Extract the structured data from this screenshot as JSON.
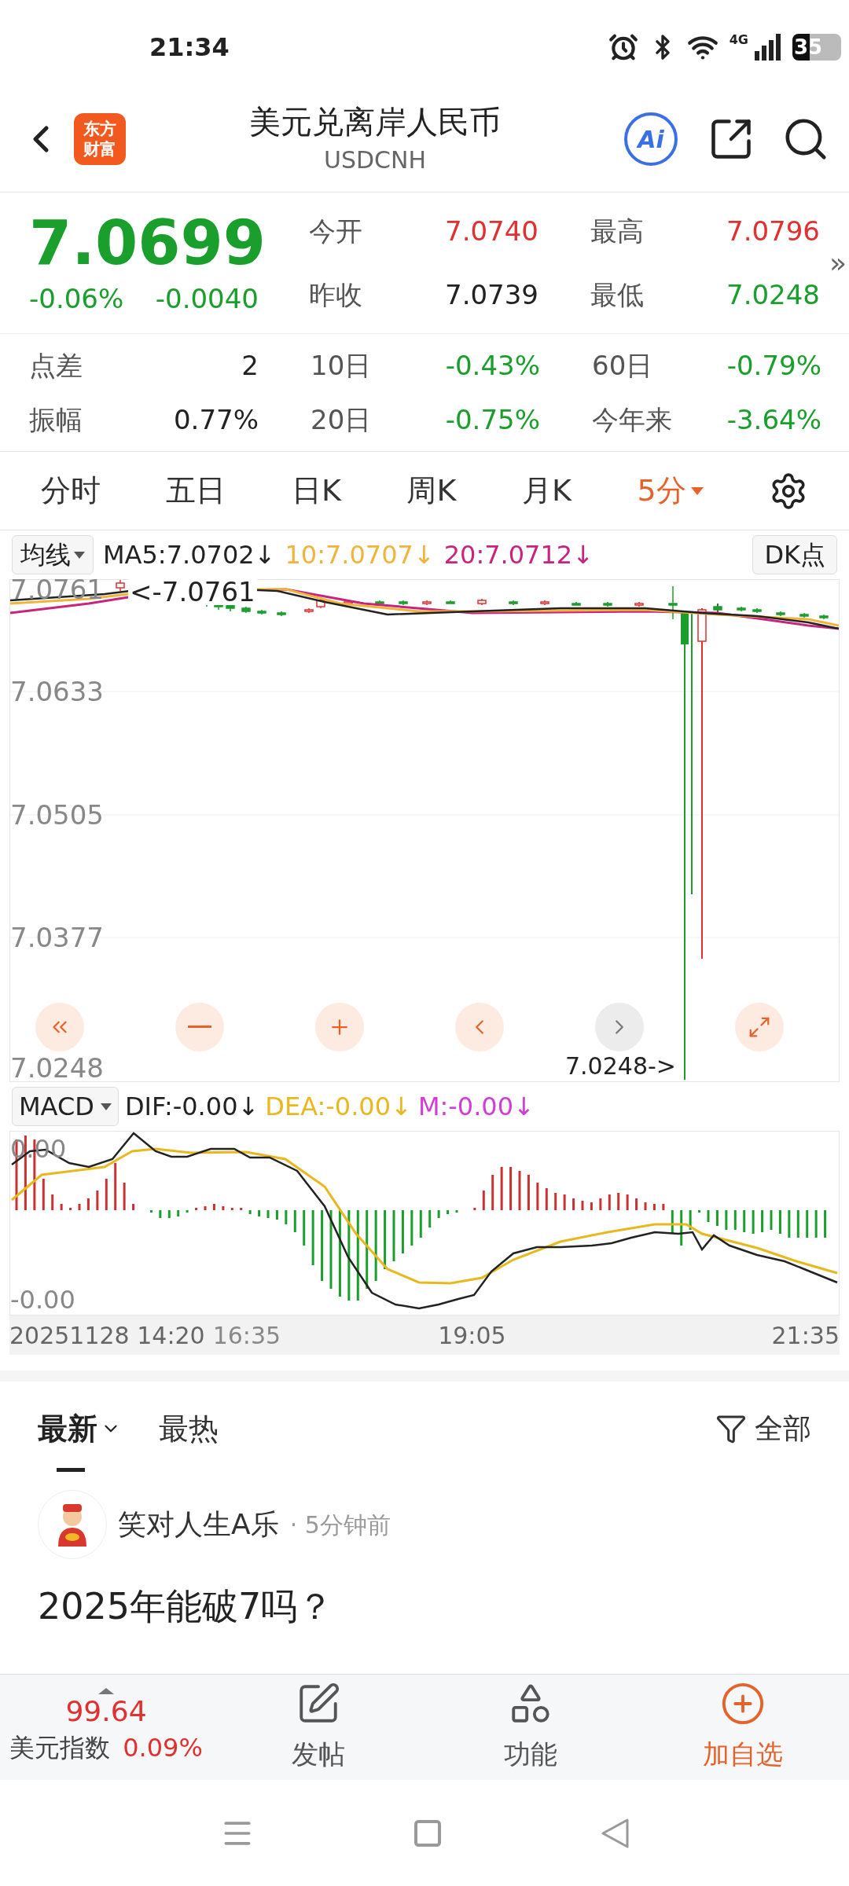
{
  "status_bar": {
    "time": "21:34",
    "network": "4G",
    "battery": "35"
  },
  "header": {
    "logo": [
      "东方",
      "财富"
    ],
    "title": "美元兑离岸人民币",
    "code": "USDCNH",
    "ai": "Ai"
  },
  "quote": {
    "price": "7.0699",
    "change_pct": "-0.06%",
    "change": "-0.0040",
    "color": "#1a9e2c",
    "stats": [
      {
        "label": "今开",
        "value": "7.0740",
        "color": "#e03030"
      },
      {
        "label": "最高",
        "value": "7.0796",
        "color": "#e03030"
      },
      {
        "label": "昨收",
        "value": "7.0739",
        "color": "#222222"
      },
      {
        "label": "最低",
        "value": "7.0248",
        "color": "#1a9e2c"
      }
    ],
    "more": "»"
  },
  "metrics": [
    {
      "label": "点差",
      "value": "2",
      "color": "#222222"
    },
    {
      "label": "10日",
      "value": "-0.43%",
      "color": "#1a9e2c"
    },
    {
      "label": "60日",
      "value": "-0.79%",
      "color": "#1a9e2c"
    },
    {
      "label": "振幅",
      "value": "0.77%",
      "color": "#222222"
    },
    {
      "label": "20日",
      "value": "-0.75%",
      "color": "#1a9e2c"
    },
    {
      "label": "今年来",
      "value": "-3.64%",
      "color": "#1a9e2c"
    }
  ],
  "chart_tabs": [
    {
      "label": "分时",
      "selected": false,
      "dropdown": false
    },
    {
      "label": "五日",
      "selected": false,
      "dropdown": false
    },
    {
      "label": "日K",
      "selected": false,
      "dropdown": false
    },
    {
      "label": "周K",
      "selected": false,
      "dropdown": false
    },
    {
      "label": "月K",
      "selected": false,
      "dropdown": false
    },
    {
      "label": "5分",
      "selected": true,
      "dropdown": true
    }
  ],
  "price_chart": {
    "selector": "均线",
    "indicators": [
      {
        "text": "MA5:7.0702↓",
        "color": "#222222"
      },
      {
        "text": "10:7.0707↓",
        "color": "#f0b43c"
      },
      {
        "text": "20:7.0712↓",
        "color": "#c8237f"
      }
    ],
    "dk_button": "DK点",
    "axis_labels": [
      "7.0761",
      "7.0633",
      "7.0505",
      "7.0377",
      "7.0248"
    ],
    "high_marker": "<-7.0761",
    "low_marker": "7.0248->",
    "controls": [
      {
        "kind": "first",
        "disabled": false
      },
      {
        "kind": "zoom_out",
        "disabled": false
      },
      {
        "kind": "zoom_in",
        "disabled": false
      },
      {
        "kind": "prev",
        "disabled": false
      },
      {
        "kind": "next",
        "disabled": true
      },
      {
        "kind": "fullscreen",
        "disabled": false
      }
    ]
  },
  "macd_chart": {
    "selector": "MACD",
    "indicators": [
      {
        "text": "DIF:-0.00↓",
        "color": "#222222"
      },
      {
        "text": "DEA:-0.00↓",
        "color": "#e8b81e"
      },
      {
        "text": "M:-0.00↓",
        "color": "#d23cd6"
      }
    ],
    "axis_labels": [
      "0.00",
      "-0.00"
    ],
    "time_labels": [
      "20251128 14:20",
      "16:35",
      "19:05",
      "21:35"
    ]
  },
  "feed_tabs": [
    {
      "label": "最新",
      "selected": true,
      "dropdown": true
    },
    {
      "label": "最热",
      "selected": false,
      "dropdown": false
    }
  ],
  "feed_filter": "全部",
  "post": {
    "author": "笑对人生A乐",
    "time": "· 5分钟前",
    "text": "2025年能破7吗？"
  },
  "bottom_bar": {
    "index_value": "99.64",
    "index_name": "美元指数",
    "index_change": "0.09%",
    "actions": [
      {
        "kind": "post",
        "label": "发帖",
        "highlight": false
      },
      {
        "kind": "apps",
        "label": "功能",
        "highlight": false
      },
      {
        "kind": "add",
        "label": "加自选",
        "highlight": true
      }
    ]
  }
}
